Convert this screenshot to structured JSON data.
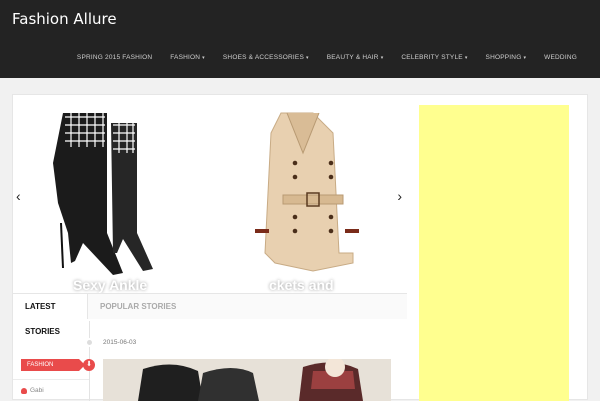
{
  "site": {
    "brand": "Fashion Allure"
  },
  "nav": [
    {
      "label": "SPRING 2015 FASHION",
      "dropdown": false
    },
    {
      "label": "FASHION",
      "dropdown": true
    },
    {
      "label": "SHOES & ACCESSORIES",
      "dropdown": true
    },
    {
      "label": "BEAUTY & HAIR",
      "dropdown": true
    },
    {
      "label": "CELEBRITY STYLE",
      "dropdown": true
    },
    {
      "label": "SHOPPING",
      "dropdown": true
    },
    {
      "label": "WEDDING",
      "dropdown": false
    }
  ],
  "slider": {
    "caption_left": "Sexy Ankle",
    "caption_right": "ckets and",
    "prev_icon": "chevron-left-icon",
    "next_icon": "chevron-right-icon"
  },
  "tabs": {
    "latest": "LATEST STORIES",
    "popular": "POPULAR STORIES"
  },
  "story": {
    "date": "2015-06-03",
    "category": "FASHION",
    "author": "Gabi"
  },
  "colors": {
    "header": "#232323",
    "accent": "#e94b4b",
    "ad": "#ffff8f"
  }
}
